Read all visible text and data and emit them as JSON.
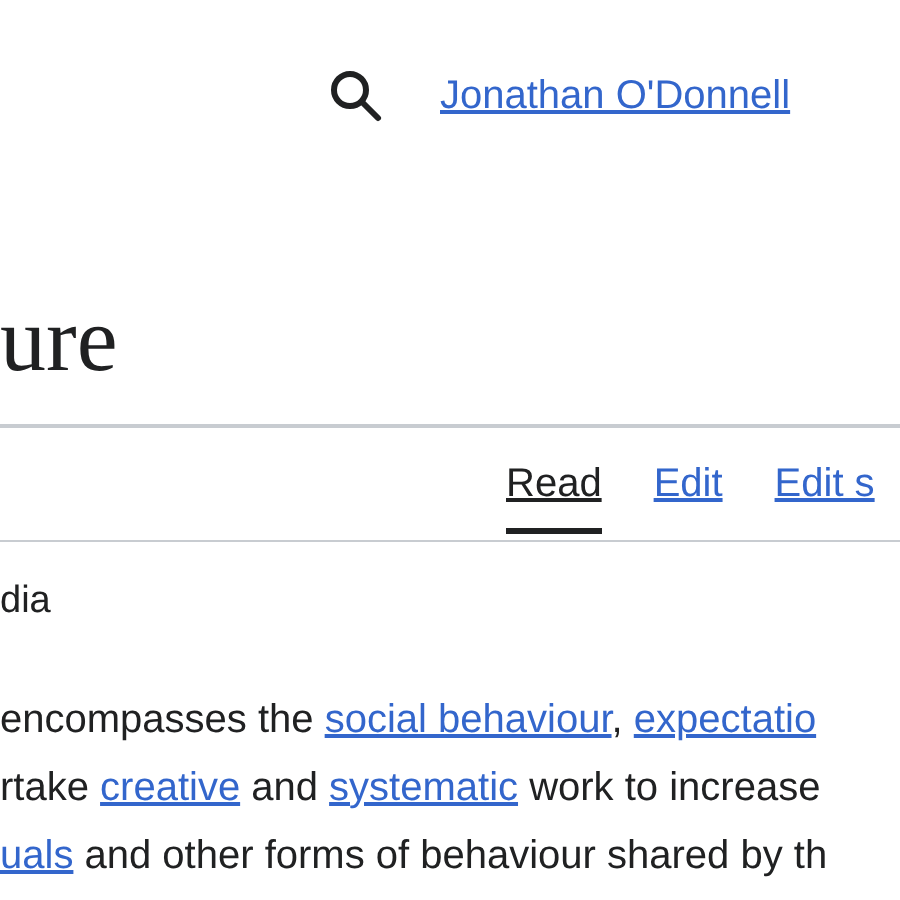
{
  "header": {
    "user_link": "Jonathan O'Donnell"
  },
  "title": "ure",
  "tabs": [
    {
      "label": "Read",
      "selected": true
    },
    {
      "label": "Edit",
      "selected": false
    },
    {
      "label": "Edit s",
      "selected": false
    }
  ],
  "tagline": "dia",
  "paragraph_lines": [
    [
      {
        "text": "encompasses the ",
        "link": false
      },
      {
        "text": "social behaviour",
        "link": true
      },
      {
        "text": ", ",
        "link": false
      },
      {
        "text": "expectatio",
        "link": true
      }
    ],
    [
      {
        "text": "rtake ",
        "link": false
      },
      {
        "text": "creative",
        "link": true
      },
      {
        "text": " and ",
        "link": false
      },
      {
        "text": "systematic",
        "link": true
      },
      {
        "text": " work to increase",
        "link": false
      }
    ],
    [
      {
        "text": "uals",
        "link": true
      },
      {
        "text": " and other forms of behaviour shared by th",
        "link": false
      }
    ]
  ]
}
